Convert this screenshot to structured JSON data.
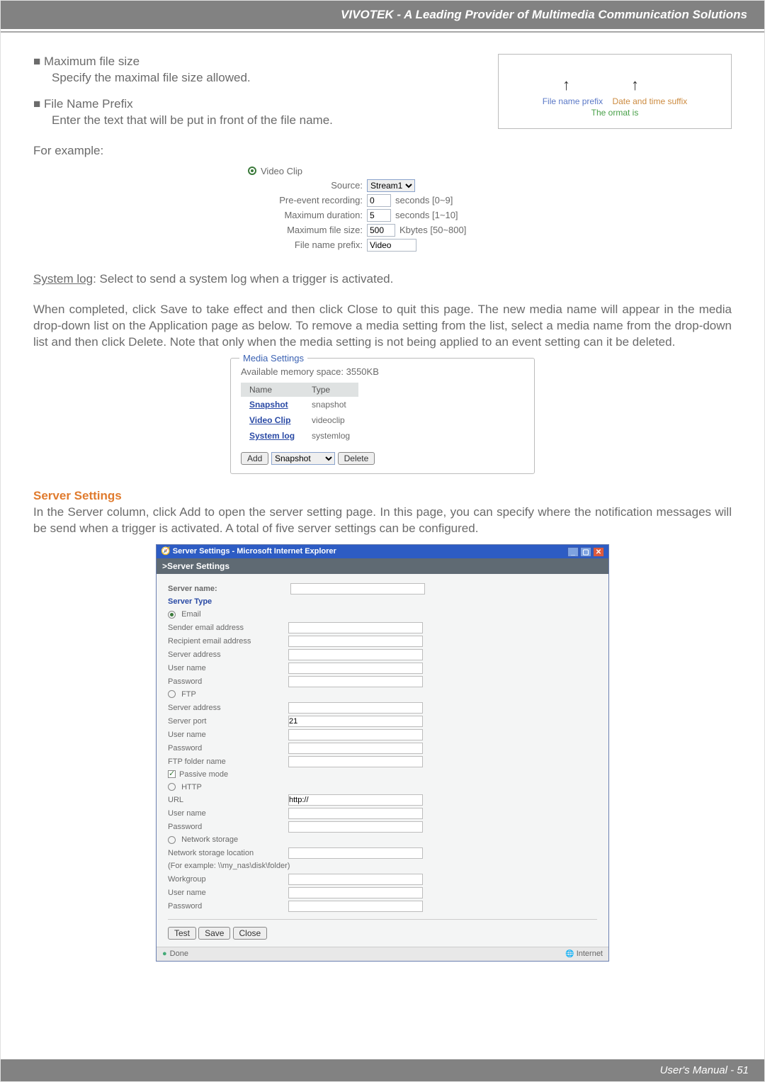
{
  "header": {
    "title": "VIVOTEK - A Leading Provider of Multimedia Communication Solutions"
  },
  "footer": {
    "text": "User's Manual - 51"
  },
  "text": {
    "maxFileSize": "■ Maximum file size",
    "maxFileSizeDesc": "Specify the maximal file size allowed.",
    "fileNamePrefix": "■ File Name Prefix",
    "fileNamePrefixDesc": "Enter the text that will be put in front of the file name.",
    "forExample": "For example:",
    "systemLogLead": "System log",
    "systemLogDesc": ": Select to send a system log when a trigger is activated.",
    "savePara": "When completed, click Save to take effect and then click Close to quit this page. The new media name will appear in the media drop-down list on the Application page as below. To remove a media setting from the list, select a media name from the drop-down list and then click Delete. Note that only when the media setting is not being applied to an event setting can it be deleted.",
    "serverSettingsHead": "Server Settings",
    "serverSettingsPara": "In the Server column, click Add to open the server setting page. In this page, you can specify where the notification messages will be send when a trigger is activated. A total of five server settings can be configured."
  },
  "fileNameDiagram": {
    "prefix": "File name prefix",
    "suffix": "Date and time suffix",
    "format": "The   ormat is"
  },
  "videoClip": {
    "title": "Video Clip",
    "sourceLabel": "Source:",
    "sourceValue": "Stream1",
    "preEventLabel": "Pre-event recording:",
    "preEventValue": "0",
    "preEventHint": "seconds [0~9]",
    "maxDurLabel": "Maximum duration:",
    "maxDurValue": "5",
    "maxDurHint": "seconds [1~10]",
    "maxSizeLabel": "Maximum file size:",
    "maxSizeValue": "500",
    "maxSizeHint": "Kbytes [50~800]",
    "prefixLabel": "File name prefix:",
    "prefixValue": "Video"
  },
  "mediaSettings": {
    "legend": "Media Settings",
    "avail": "Available memory space: 3550KB",
    "cols": {
      "name": "Name",
      "type": "Type"
    },
    "rows": [
      {
        "name": "Snapshot",
        "type": "snapshot"
      },
      {
        "name": "Video Clip",
        "type": "videoclip"
      },
      {
        "name": "System log",
        "type": "systemlog"
      }
    ],
    "addBtn": "Add",
    "dropdown": "Snapshot",
    "deleteBtn": "Delete"
  },
  "serverWindow": {
    "title": "Server Settings - Microsoft Internet Explorer",
    "sub": ">Server Settings",
    "serverNameLabel": "Server name:",
    "serverTypeLabel": "Server Type",
    "email": {
      "label": "Email",
      "sender": "Sender email address",
      "recipient": "Recipient email address",
      "server": "Server address",
      "user": "User name",
      "pass": "Password"
    },
    "ftp": {
      "label": "FTP",
      "server": "Server address",
      "port": "Server port",
      "portValue": "21",
      "user": "User name",
      "pass": "Password",
      "folder": "FTP folder name",
      "passive": "Passive mode"
    },
    "http": {
      "label": "HTTP",
      "url": "URL",
      "urlValue": "http://",
      "user": "User name",
      "pass": "Password"
    },
    "ns": {
      "label": "Network storage",
      "loc": "Network storage location",
      "example": "(For example: \\\\my_nas\\disk\\folder)",
      "workgroup": "Workgroup",
      "user": "User name",
      "pass": "Password"
    },
    "buttons": {
      "test": "Test",
      "save": "Save",
      "close": "Close"
    },
    "status": {
      "done": "Done",
      "zone": "Internet"
    }
  }
}
